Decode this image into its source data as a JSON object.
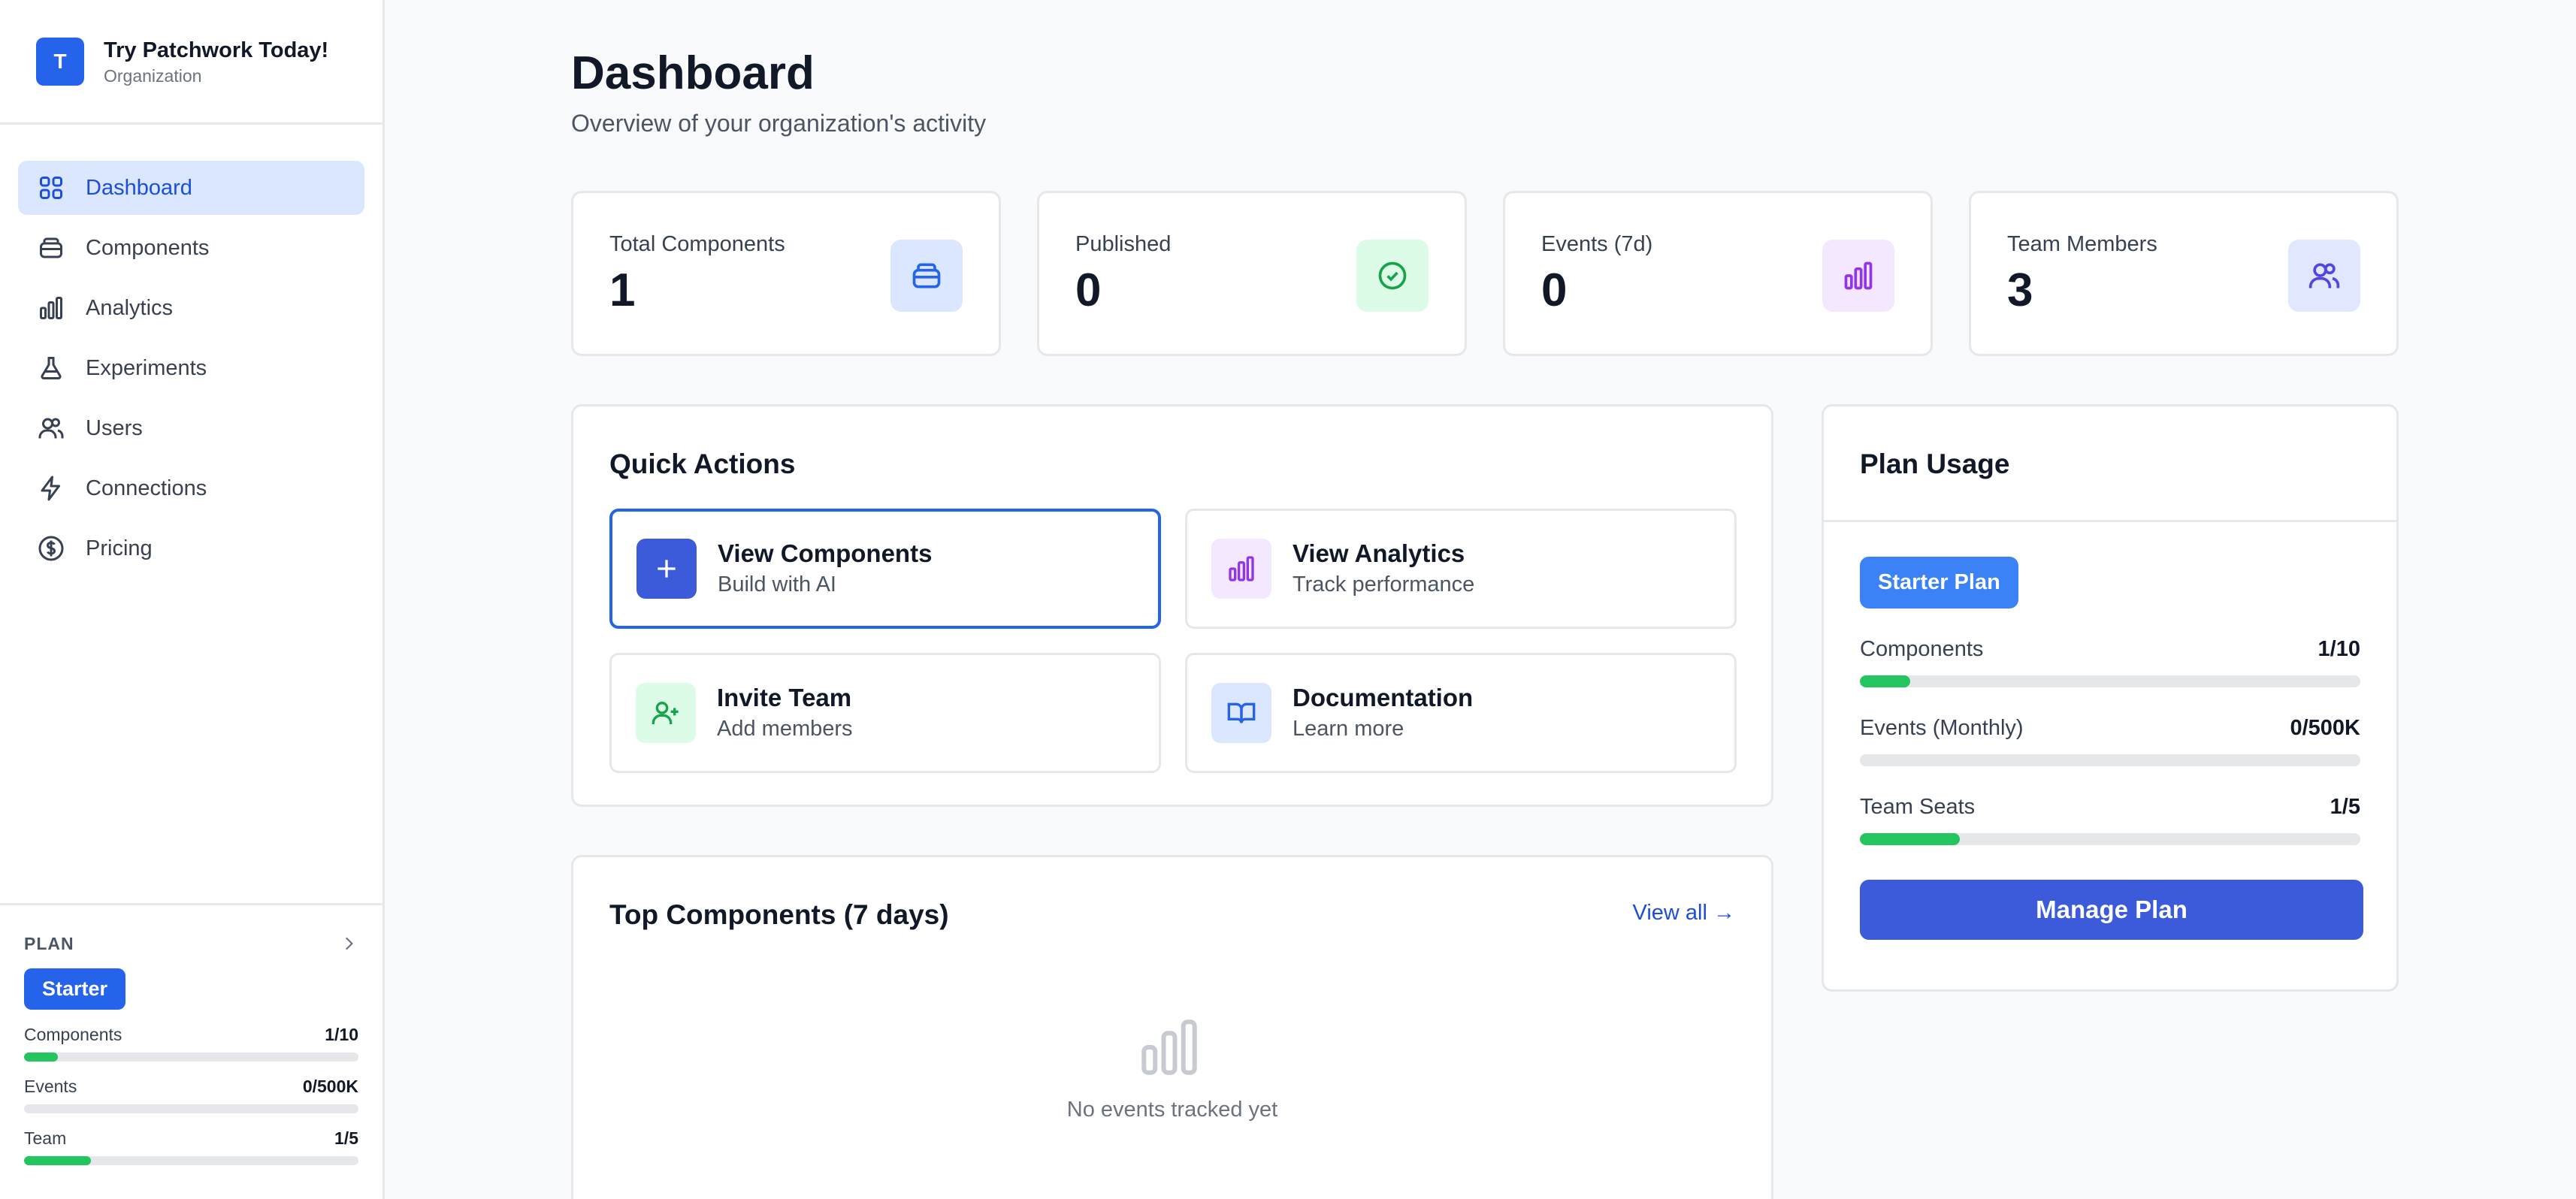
{
  "org": {
    "avatar_letter": "T",
    "name": "Try Patchwork Today!",
    "subtitle": "Organization"
  },
  "nav": [
    {
      "label": "Dashboard",
      "icon": "grid-icon",
      "active": true
    },
    {
      "label": "Components",
      "icon": "box-icon",
      "active": false
    },
    {
      "label": "Analytics",
      "icon": "bar-chart-icon",
      "active": false
    },
    {
      "label": "Experiments",
      "icon": "flask-icon",
      "active": false
    },
    {
      "label": "Users",
      "icon": "users-icon",
      "active": false
    },
    {
      "label": "Connections",
      "icon": "zap-icon",
      "active": false
    },
    {
      "label": "Pricing",
      "icon": "dollar-circle-icon",
      "active": false
    }
  ],
  "sidebar_plan": {
    "label": "PLAN",
    "badge": "Starter",
    "rows": [
      {
        "label": "Components",
        "value": "1/10",
        "fraction": 0.1
      },
      {
        "label": "Events",
        "value": "0/500K",
        "fraction": 0.0
      },
      {
        "label": "Team",
        "value": "1/5",
        "fraction": 0.2
      }
    ]
  },
  "header": {
    "title": "Dashboard",
    "subtitle": "Overview of your organization's activity"
  },
  "stats": [
    {
      "label": "Total Components",
      "value": "1",
      "icon": "box-icon",
      "color": "#2563eb",
      "bg": "#dbe7fe"
    },
    {
      "label": "Published",
      "value": "0",
      "icon": "check-circle-icon",
      "color": "#16a34a",
      "bg": "#dcfce7"
    },
    {
      "label": "Events (7d)",
      "value": "0",
      "icon": "bar-chart-icon",
      "color": "#9333ea",
      "bg": "#f3e8ff"
    },
    {
      "label": "Team Members",
      "value": "3",
      "icon": "users-icon",
      "color": "#4f46e5",
      "bg": "#e0e7ff"
    }
  ],
  "quick_actions": {
    "title": "Quick Actions",
    "items": [
      {
        "title": "View Components",
        "subtitle": "Build with AI",
        "icon": "plus-icon"
      },
      {
        "title": "View Analytics",
        "subtitle": "Track performance",
        "icon": "bar-chart-icon"
      },
      {
        "title": "Invite Team",
        "subtitle": "Add members",
        "icon": "user-plus-icon"
      },
      {
        "title": "Documentation",
        "subtitle": "Learn more",
        "icon": "book-open-icon"
      }
    ]
  },
  "top_components": {
    "title": "Top Components (7 days)",
    "view_all": "View all →",
    "empty_text": "No events tracked yet"
  },
  "plan_usage": {
    "title": "Plan Usage",
    "badge": "Starter Plan",
    "rows": [
      {
        "label": "Components",
        "value": "1/10",
        "fraction": 0.1
      },
      {
        "label": "Events (Monthly)",
        "value": "0/500K",
        "fraction": 0.0
      },
      {
        "label": "Team Seats",
        "value": "1/5",
        "fraction": 0.2
      }
    ],
    "button": "Manage Plan"
  }
}
